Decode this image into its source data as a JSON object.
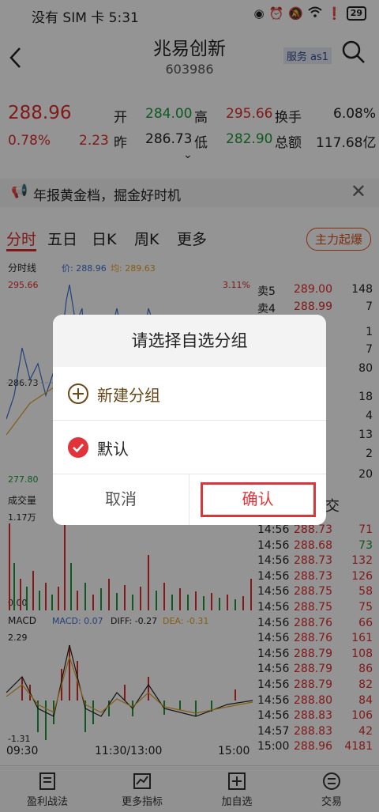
{
  "status": {
    "carrier": "没有 SIM 卡 5:31",
    "battery": "29"
  },
  "header": {
    "name": "兆易创新",
    "code": "603986",
    "service": "服务 as1"
  },
  "quote": {
    "price": "288.96",
    "pct": "0.78%",
    "chg": "2.23",
    "open_label": "开",
    "open": "284.00",
    "prev_label": "昨",
    "prev": "286.73",
    "high_label": "高",
    "high": "295.66",
    "low_label": "低",
    "low": "282.90",
    "turnover_label": "换手",
    "turnover": "6.08%",
    "amount_label": "总额",
    "amount": "117.68亿"
  },
  "news": {
    "text": "年报黄金档，掘金好时机"
  },
  "tabs": {
    "t1": "分时",
    "t2": "五日",
    "t3": "日K",
    "t4": "周K",
    "t5": "更多",
    "hot": "主力起爆"
  },
  "chart": {
    "mode": "分时线",
    "price_label": "价: 288.96",
    "avg_label": "均: 289.63",
    "top": "295.66",
    "mid": "286.73",
    "bottom": "277.80",
    "pct_top": "3.11%",
    "vol_label": "成交量",
    "vol_max": "1.17万",
    "vol_min": "0.00",
    "macd": "MACD",
    "macd_val": "MACD: 0.07",
    "diff": "DIFF: -0.27",
    "dea": "DEA: -0.31",
    "macd_top": "2.29",
    "macd_bottom": "-1.31",
    "t_start": "09:30",
    "t_mid": "11:30/13:00",
    "t_end": "15:00"
  },
  "book": [
    {
      "label": "卖5",
      "price": "289.00",
      "vol": "148"
    },
    {
      "label": "卖4",
      "price": "288.99",
      "vol": "7"
    }
  ],
  "book_vols": [
    "1",
    "7",
    "80",
    "18",
    "4",
    "13",
    "2",
    "20"
  ],
  "trades_header": "交",
  "trades": [
    {
      "t": "14:56",
      "p": "288.73",
      "v": "71",
      "c": "red"
    },
    {
      "t": "14:56",
      "p": "288.68",
      "v": "73",
      "c": "green"
    },
    {
      "t": "14:56",
      "p": "288.73",
      "v": "132",
      "c": "red"
    },
    {
      "t": "14:56",
      "p": "288.73",
      "v": "126",
      "c": "red"
    },
    {
      "t": "14:56",
      "p": "288.75",
      "v": "58",
      "c": "red"
    },
    {
      "t": "14:56",
      "p": "288.75",
      "v": "75",
      "c": "red"
    },
    {
      "t": "14:56",
      "p": "288.76",
      "v": "66",
      "c": "red"
    },
    {
      "t": "14:56",
      "p": "288.76",
      "v": "161",
      "c": "red"
    },
    {
      "t": "14:56",
      "p": "288.79",
      "v": "108",
      "c": "red"
    },
    {
      "t": "14:56",
      "p": "288.79",
      "v": "86",
      "c": "red"
    },
    {
      "t": "14:56",
      "p": "288.79",
      "v": "82",
      "c": "red"
    },
    {
      "t": "14:56",
      "p": "288.80",
      "v": "84",
      "c": "red"
    },
    {
      "t": "14:56",
      "p": "288.83",
      "v": "106",
      "c": "red"
    },
    {
      "t": "14:57",
      "p": "288.83",
      "v": "42",
      "c": "red"
    },
    {
      "t": "15:00",
      "p": "288.96",
      "v": "4181",
      "c": "red"
    }
  ],
  "bottom": {
    "b1": "盈利战法",
    "b2": "更多指标",
    "b3": "加自选",
    "b4": "交易"
  },
  "dialog": {
    "title": "请选择自选分组",
    "new_group": "新建分组",
    "default": "默认",
    "cancel": "取消",
    "confirm": "确认"
  }
}
